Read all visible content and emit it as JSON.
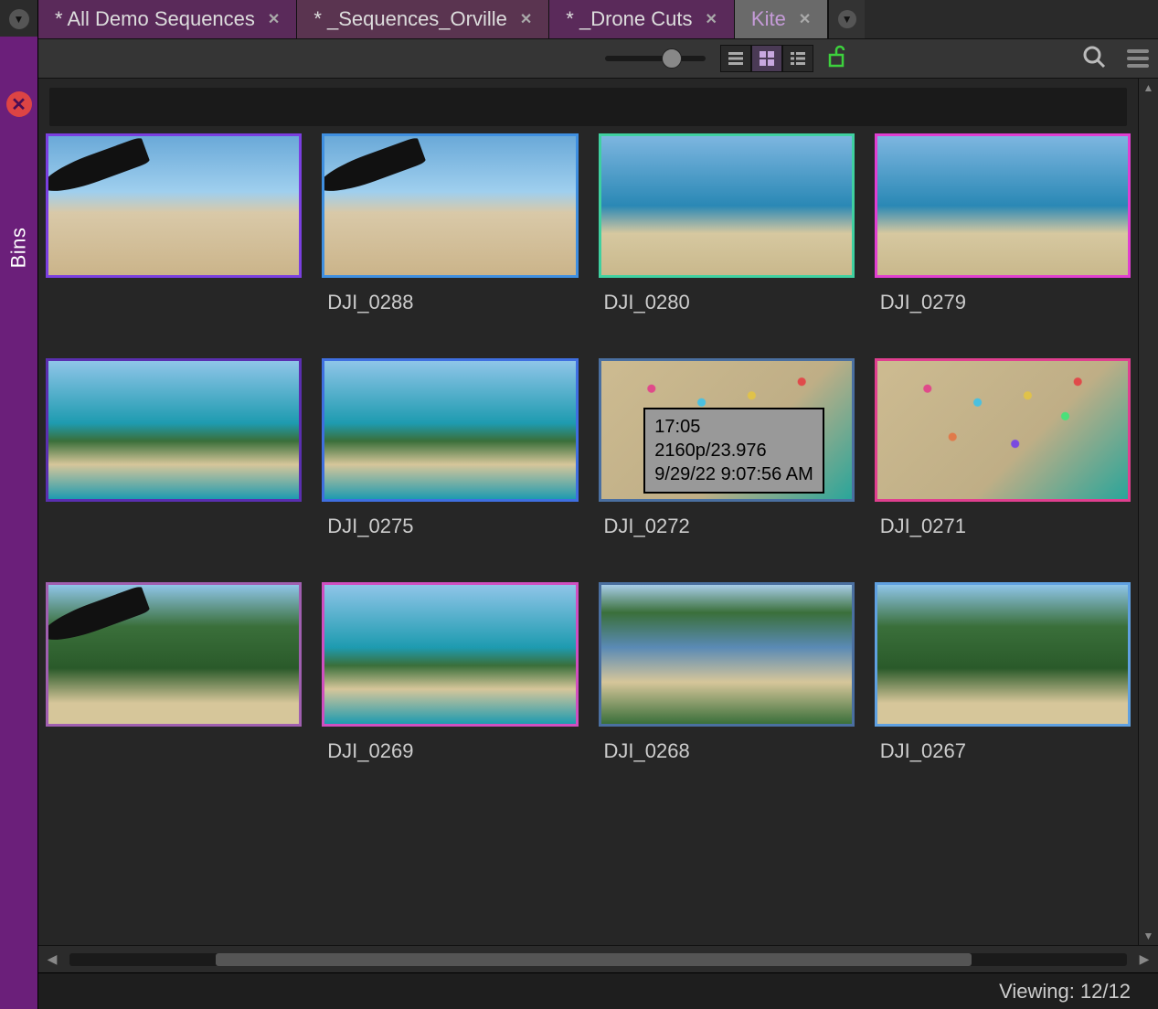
{
  "sidebar": {
    "bins_label": "Bins"
  },
  "tabs": [
    {
      "label": "* All Demo Sequences",
      "active": false
    },
    {
      "label": "* _Sequences_Orville",
      "active": false
    },
    {
      "label": "* _Drone Cuts",
      "active": false
    },
    {
      "label": "Kite",
      "active": true
    }
  ],
  "clips": [
    {
      "label": "",
      "border": "#7a3fe0",
      "art": "sky",
      "kite": true
    },
    {
      "label": "DJI_0288",
      "border": "#3f8fe0",
      "art": "sky",
      "kite": true
    },
    {
      "label": "DJI_0280",
      "border": "#3fd0a0",
      "art": "sea",
      "kite": false
    },
    {
      "label": "DJI_0279",
      "border": "#e03fd0",
      "art": "sea",
      "kite": false
    },
    {
      "label": "",
      "border": "#5a2fb0",
      "art": "coast",
      "kite": false
    },
    {
      "label": "DJI_0275",
      "border": "#3f6fe0",
      "art": "coast",
      "kite": false
    },
    {
      "label": "DJI_0272",
      "border": "#4a6fa0",
      "art": "topdown",
      "kite": false,
      "tooltip": {
        "l1": "17:05",
        "l2": "2160p/23.976",
        "l3": "9/29/22 9:07:56 AM"
      }
    },
    {
      "label": "DJI_0271",
      "border": "#e03f8f",
      "art": "topdown",
      "kite": false
    },
    {
      "label": "",
      "border": "#a05fb0",
      "art": "green",
      "kite": true
    },
    {
      "label": "DJI_0269",
      "border": "#d04fc0",
      "art": "coast",
      "kite": false
    },
    {
      "label": "DJI_0268",
      "border": "#4a6fa0",
      "art": "river",
      "kite": false
    },
    {
      "label": "DJI_0267",
      "border": "#5fa0e0",
      "art": "green",
      "kite": false
    }
  ],
  "status": {
    "viewing_label": "Viewing: 12/12"
  }
}
